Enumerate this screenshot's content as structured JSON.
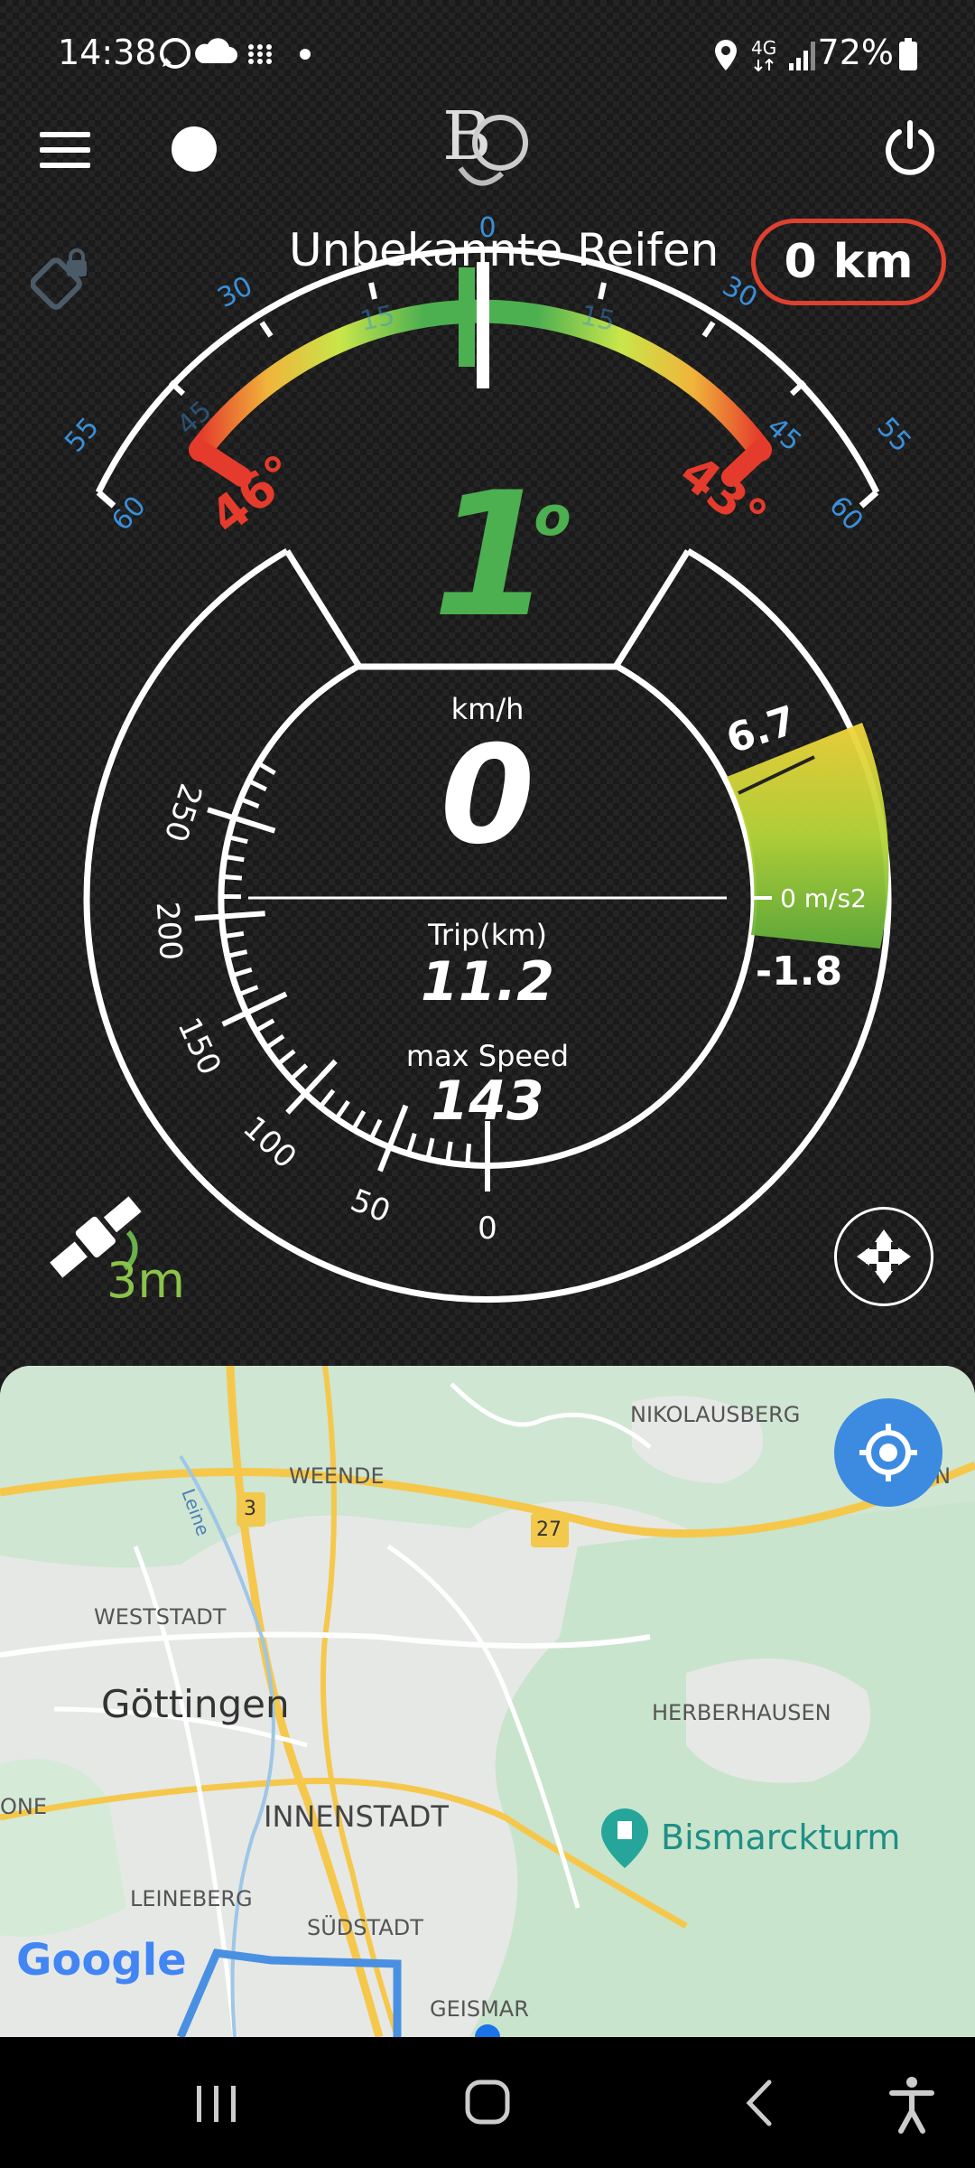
{
  "status_bar": {
    "time": "14:38",
    "network": "4G",
    "battery": "72%"
  },
  "app": {
    "logo_text": "BO",
    "tyre_label": "Unbekannte Reifen",
    "distance_badge": "0 km"
  },
  "lean_gauge": {
    "scale_center": "0",
    "scale_left": [
      "15",
      "30",
      "45",
      "55",
      "60"
    ],
    "scale_right": [
      "15",
      "30",
      "45",
      "55",
      "60"
    ],
    "max_left": "46°",
    "max_right": "43°",
    "current_angle": "1",
    "degree_symbol": "o"
  },
  "speedometer": {
    "unit": "km/h",
    "speed": "0",
    "ticks": [
      "250",
      "200",
      "150",
      "100",
      "50",
      "0"
    ],
    "trip_label": "Trip(km)",
    "trip_value": "11.2",
    "max_label": "max Speed",
    "max_value": "143"
  },
  "accel": {
    "max": "6.7",
    "current": "0 m/s2",
    "min": "-1.8"
  },
  "gps": {
    "accuracy": "3m"
  },
  "map": {
    "labels": {
      "nikolausberg": "NIKOLAUSBERG",
      "weende": "WEENDE",
      "leine": "Leine",
      "road3": "3",
      "road27": "27",
      "weststadt": "WESTSTADT",
      "goettingen": "Göttingen",
      "herberhausen": "HERBERHAUSEN",
      "one": "ONE",
      "innenstadt": "INNENSTADT",
      "bismarckturm": "Bismarckturm",
      "leineberg": "LEINEBERG",
      "suedstadt": "SÜDSTADT",
      "geismar": "GEISMAR",
      "en": "EN",
      "google": "Google"
    }
  },
  "colors": {
    "green": "#4caf50",
    "red": "#e0402f",
    "blue_scale": "#3a8fd8",
    "accel_yellow": "#f2d43a"
  }
}
